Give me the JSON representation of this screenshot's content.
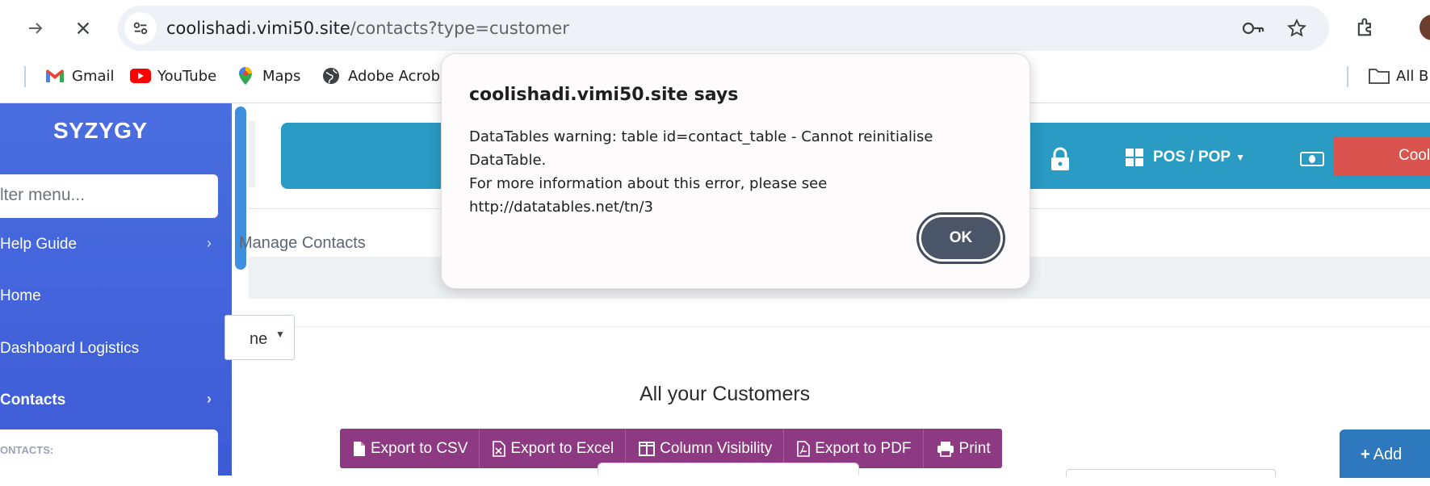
{
  "browser": {
    "url_host": "coolishadi.vimi50.site",
    "url_path": "/contacts?type=customer",
    "bookmarks": [
      "Gmail",
      "YouTube",
      "Maps",
      "Adobe Acroba",
      "All B"
    ]
  },
  "sidebar": {
    "brand": "SYZYGY",
    "filter_placeholder": "lter menu...",
    "items": [
      {
        "label": "Help Guide"
      },
      {
        "label": "Home"
      },
      {
        "label": "Dashboard Logistics"
      },
      {
        "label": "Contacts"
      }
    ],
    "submenu_header": "ONTACTS:"
  },
  "header": {
    "pos_menu": "POS / POP",
    "cool_button": "Cool"
  },
  "main": {
    "breadcrumb": "Manage Contacts",
    "select_value": "ne",
    "section_title": "All your Customers",
    "buttons": [
      "Export to CSV",
      "Export to Excel",
      "Column Visibility",
      "Export to PDF",
      "Print"
    ],
    "add_button": "Add"
  },
  "dialog": {
    "title": "coolishadi.vimi50.site says",
    "line1": "DataTables warning: table id=contact_table - Cannot reinitialise DataTable.",
    "line2": "For more information about this error, please see http://datatables.net/tn/3",
    "ok": "OK"
  },
  "colors": {
    "sidebar": "#4a6ee0",
    "header_bar": "#2a9bc3",
    "button_group": "#8e3a82",
    "cool_button": "#d9534f",
    "add_button": "#2e79bd"
  }
}
